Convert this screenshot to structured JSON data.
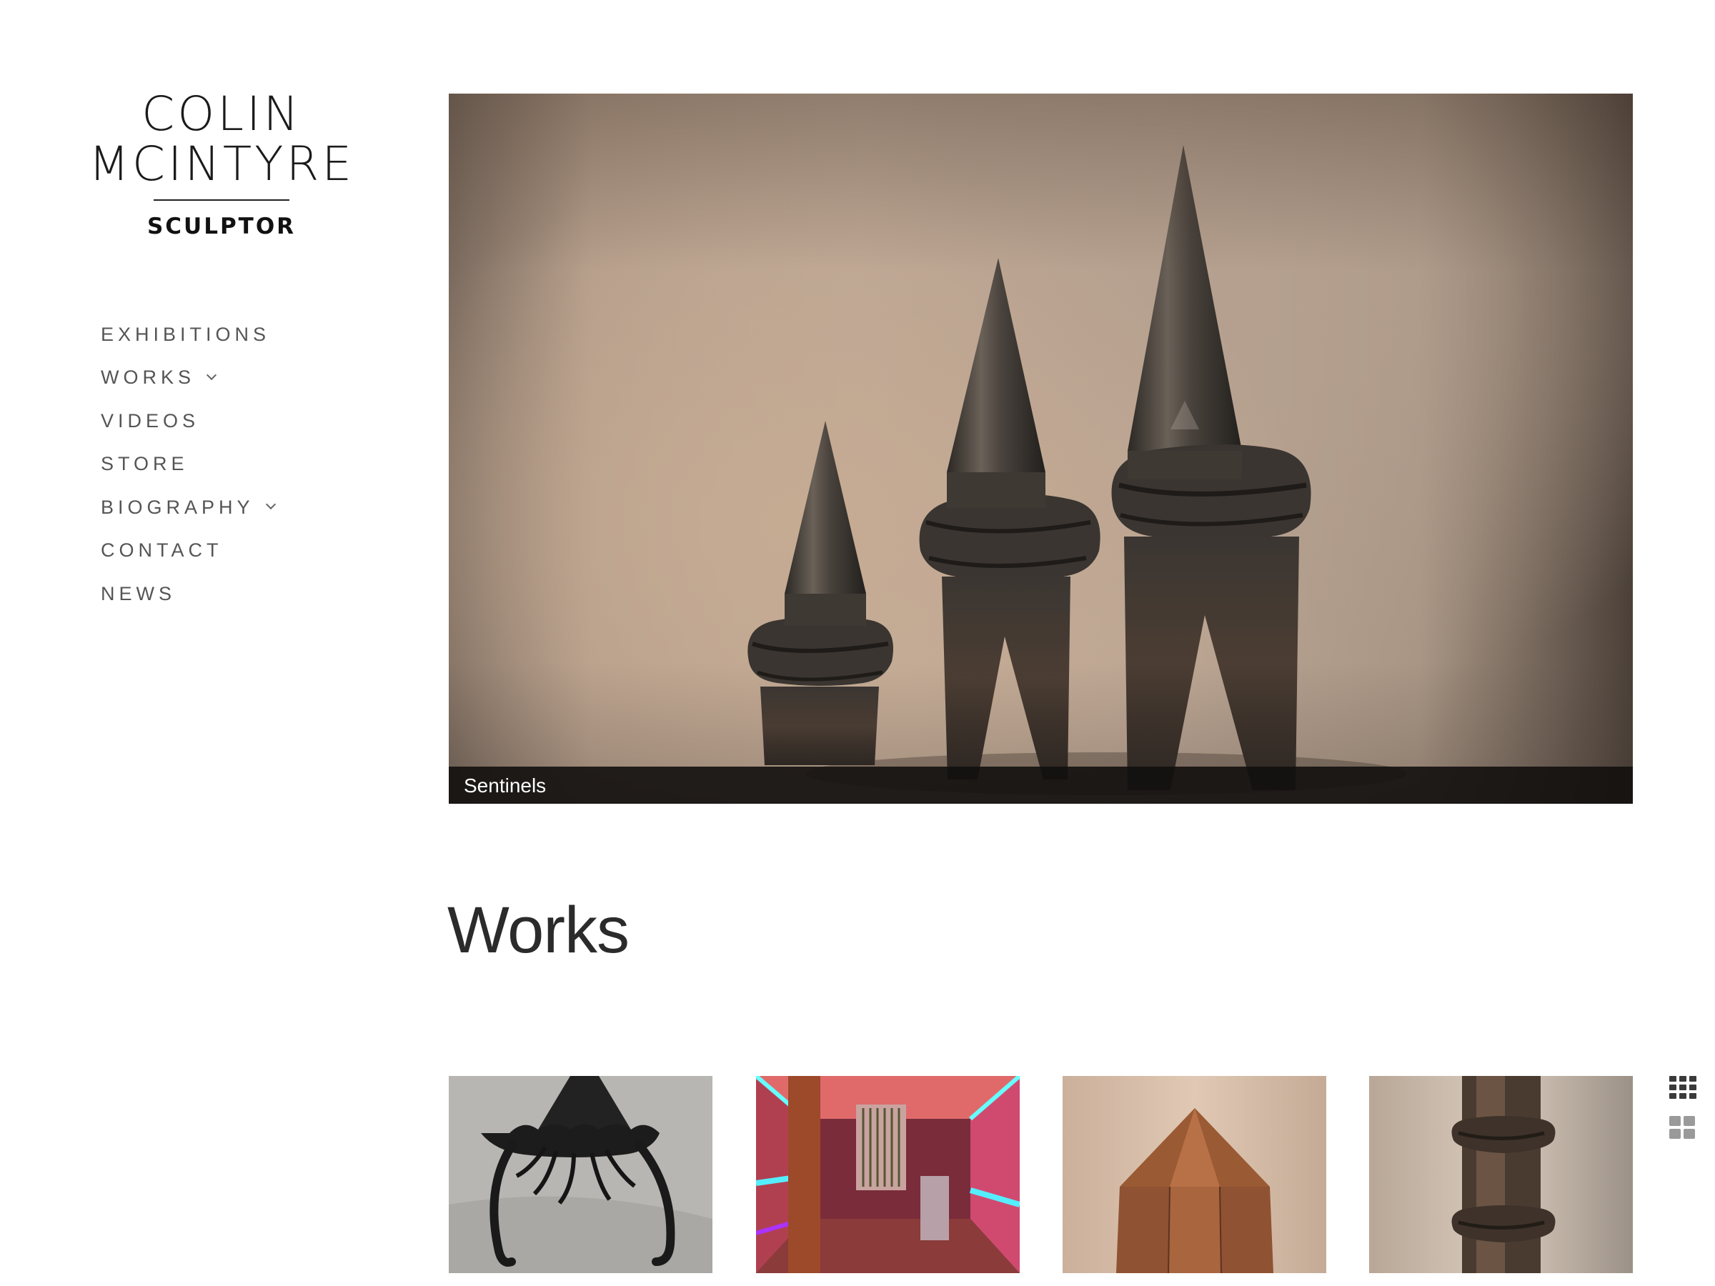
{
  "logo": {
    "line1": "COLIN",
    "line2": "MCINTYRE",
    "line3": "SCULPTOR"
  },
  "nav": {
    "items": [
      {
        "label": "EXHIBITIONS",
        "has_submenu": false
      },
      {
        "label": "WORKS",
        "has_submenu": true
      },
      {
        "label": "VIDEOS",
        "has_submenu": false
      },
      {
        "label": "STORE",
        "has_submenu": false
      },
      {
        "label": "BIOGRAPHY",
        "has_submenu": true
      },
      {
        "label": "CONTACT",
        "has_submenu": false
      },
      {
        "label": "NEWS",
        "has_submenu": false
      }
    ]
  },
  "hero": {
    "caption": "Sentinels"
  },
  "works": {
    "title": "Works",
    "thumbnails": [
      {
        "subject": "black hanging jellyfish-like metal sculpture"
      },
      {
        "subject": "neon-lit corridor installation"
      },
      {
        "subject": "rusted steel hexagonal point"
      },
      {
        "subject": "twisted rusted steel column"
      }
    ]
  },
  "view_toggles": {
    "small_grid_icon": "grid-small-icon",
    "large_grid_icon": "grid-large-icon"
  },
  "colors": {
    "nav_text": "#555555",
    "title_text": "#2b2b2b",
    "caption_bg": "#121010"
  }
}
